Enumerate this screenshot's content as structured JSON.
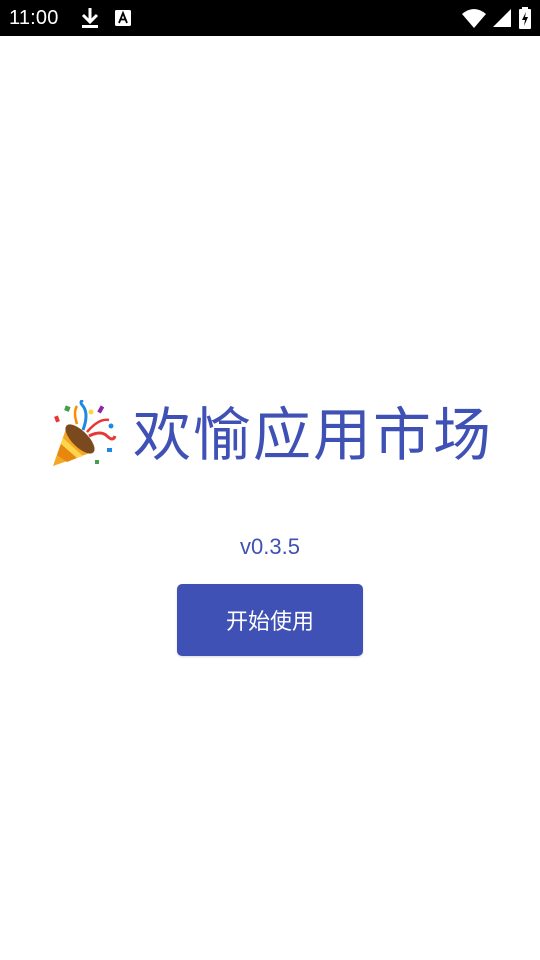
{
  "status_bar": {
    "time": "11:00",
    "icons": [
      "download-icon",
      "notification-a-icon",
      "wifi-icon",
      "cell-signal-icon",
      "battery-charging-icon"
    ],
    "background": "#000000"
  },
  "app": {
    "title": "欢愉应用市场",
    "title_icon": "party-popper-icon",
    "version": "v0.3.5",
    "start_button_label": "开始使用",
    "accent_color": "#3F51B5"
  }
}
